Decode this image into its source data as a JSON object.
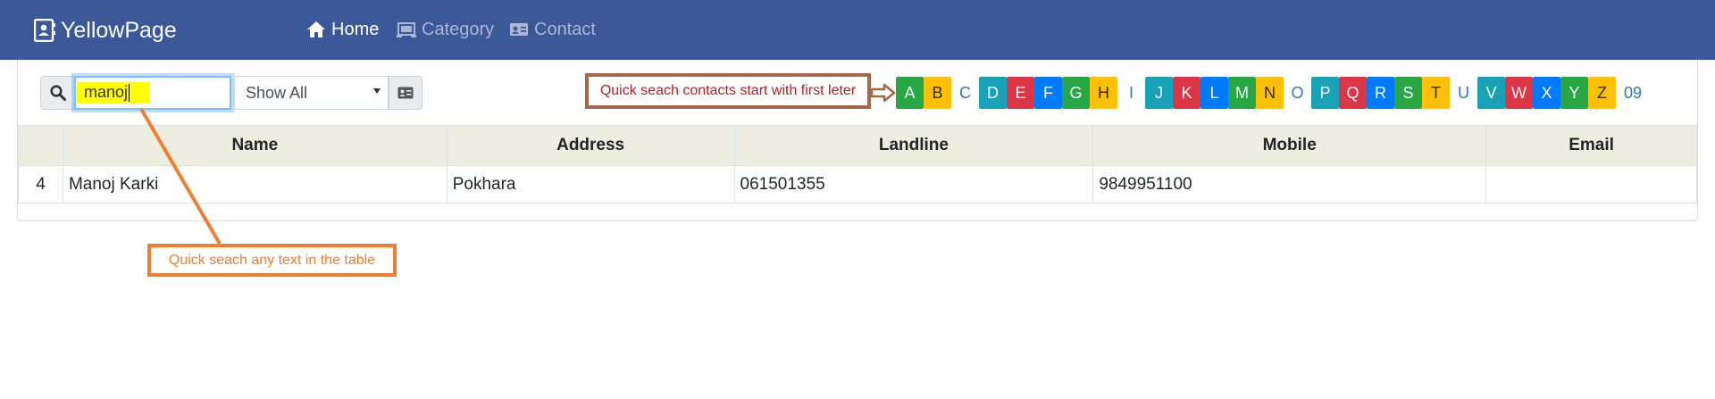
{
  "navbar": {
    "brand": "YellowPage",
    "items": [
      {
        "label": "Home",
        "icon": "home-icon",
        "active": true
      },
      {
        "label": "Category",
        "icon": "category-icon",
        "active": false
      },
      {
        "label": "Contact",
        "icon": "contact-card-icon",
        "active": false
      }
    ]
  },
  "search": {
    "value": "manoj",
    "select_value": "Show All"
  },
  "annotations": {
    "first_letter": "Quick seach contacts start with first leter",
    "table_search": "Quick seach any text in the table"
  },
  "alphabet": [
    {
      "label": "A",
      "color": "#28a745"
    },
    {
      "label": "B",
      "color": "#ffc107"
    },
    {
      "label": "C",
      "color": "#ffffff"
    },
    {
      "label": "D",
      "color": "#17a2b8"
    },
    {
      "label": "E",
      "color": "#dc3545"
    },
    {
      "label": "F",
      "color": "#007bff"
    },
    {
      "label": "G",
      "color": "#28a745"
    },
    {
      "label": "H",
      "color": "#ffc107"
    },
    {
      "label": "I",
      "color": "#ffffff"
    },
    {
      "label": "J",
      "color": "#17a2b8"
    },
    {
      "label": "K",
      "color": "#dc3545"
    },
    {
      "label": "L",
      "color": "#007bff"
    },
    {
      "label": "M",
      "color": "#28a745"
    },
    {
      "label": "N",
      "color": "#ffc107"
    },
    {
      "label": "O",
      "color": "#ffffff"
    },
    {
      "label": "P",
      "color": "#17a2b8"
    },
    {
      "label": "Q",
      "color": "#dc3545"
    },
    {
      "label": "R",
      "color": "#007bff"
    },
    {
      "label": "S",
      "color": "#28a745"
    },
    {
      "label": "T",
      "color": "#ffc107"
    },
    {
      "label": "U",
      "color": "#ffffff"
    },
    {
      "label": "V",
      "color": "#17a2b8"
    },
    {
      "label": "W",
      "color": "#dc3545"
    },
    {
      "label": "X",
      "color": "#007bff"
    },
    {
      "label": "Y",
      "color": "#28a745"
    },
    {
      "label": "Z",
      "color": "#ffc107"
    },
    {
      "label": "09",
      "color": "#ffffff"
    }
  ],
  "table": {
    "headers": [
      "",
      "Name",
      "Address",
      "Landline",
      "Mobile",
      "Email"
    ],
    "rows": [
      [
        "4",
        "Manoj Karki",
        "Pokhara",
        "061501355",
        "9849951100",
        ""
      ]
    ]
  },
  "colors": {
    "navbar": "#3b5998",
    "header_row": "#eeeee0",
    "highlight": "#ffff00",
    "callout_orange": "#ef7f30",
    "callout_brown": "#a6684a",
    "callout_text_red": "#b22222"
  }
}
